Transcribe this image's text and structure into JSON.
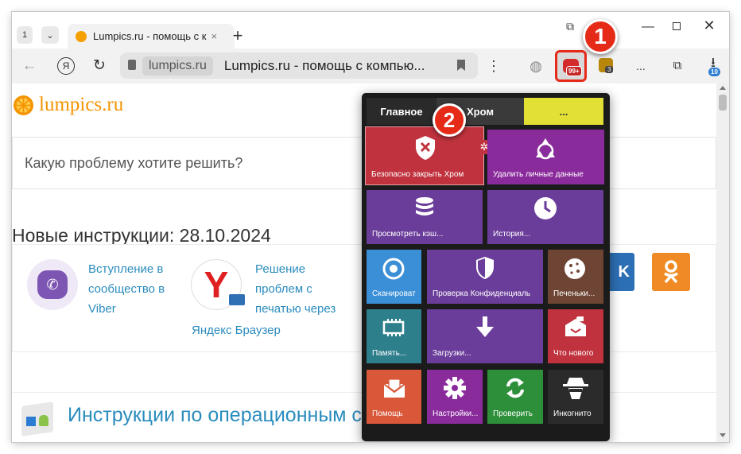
{
  "tabstrip": {
    "tab_counter": "1",
    "tab_title": "Lumpics.ru - помощь с к",
    "new_tab": "+"
  },
  "toolbar": {
    "host": "lumpics.ru",
    "page_title": "Lumpics.ru - помощь с компью...",
    "yandex_glyph": "Я",
    "extension_badge": "99+",
    "ext2_badge": "3",
    "downloads_badge": "10",
    "more": "..."
  },
  "page": {
    "logo_text": "lumpics.ru",
    "search_placeholder": "Какую проблему хотите решить?",
    "heading": "Новые инструкции: 28.10.2024",
    "card1": [
      "Вступление в",
      "сообщество в",
      "Viber"
    ],
    "card2": [
      "Решение",
      "проблем с",
      "печатью через"
    ],
    "card2_tail": "Яндекс Браузер",
    "os_heading": "Инструкции по операционным с"
  },
  "popup": {
    "tabs": [
      "Главное",
      "Хром",
      "..."
    ],
    "tiles": [
      "Безопасно закрыть Хром",
      "Удалить личные данные",
      "Просмотреть кэш...",
      "История...",
      "Сканироват",
      "Проверка Конфиденциаль",
      "Печеньки...",
      "Память...",
      "Загрузки...",
      "Что нового",
      "Помощь",
      "Настройки...",
      "Проверить",
      "Инкогнито"
    ]
  },
  "callouts": [
    "1",
    "2"
  ],
  "colors": {
    "accent_orange": "#f39400",
    "link_blue": "#2a8cbd",
    "callout_red": "#e52a18",
    "tile_red": "#c0333e",
    "tile_purple": "#6a3d9a",
    "tile_teal": "#2e7f8c",
    "tile_green": "#2d8f3a",
    "tile_orange": "#d9583a",
    "tile_brown": "#6e4534"
  }
}
